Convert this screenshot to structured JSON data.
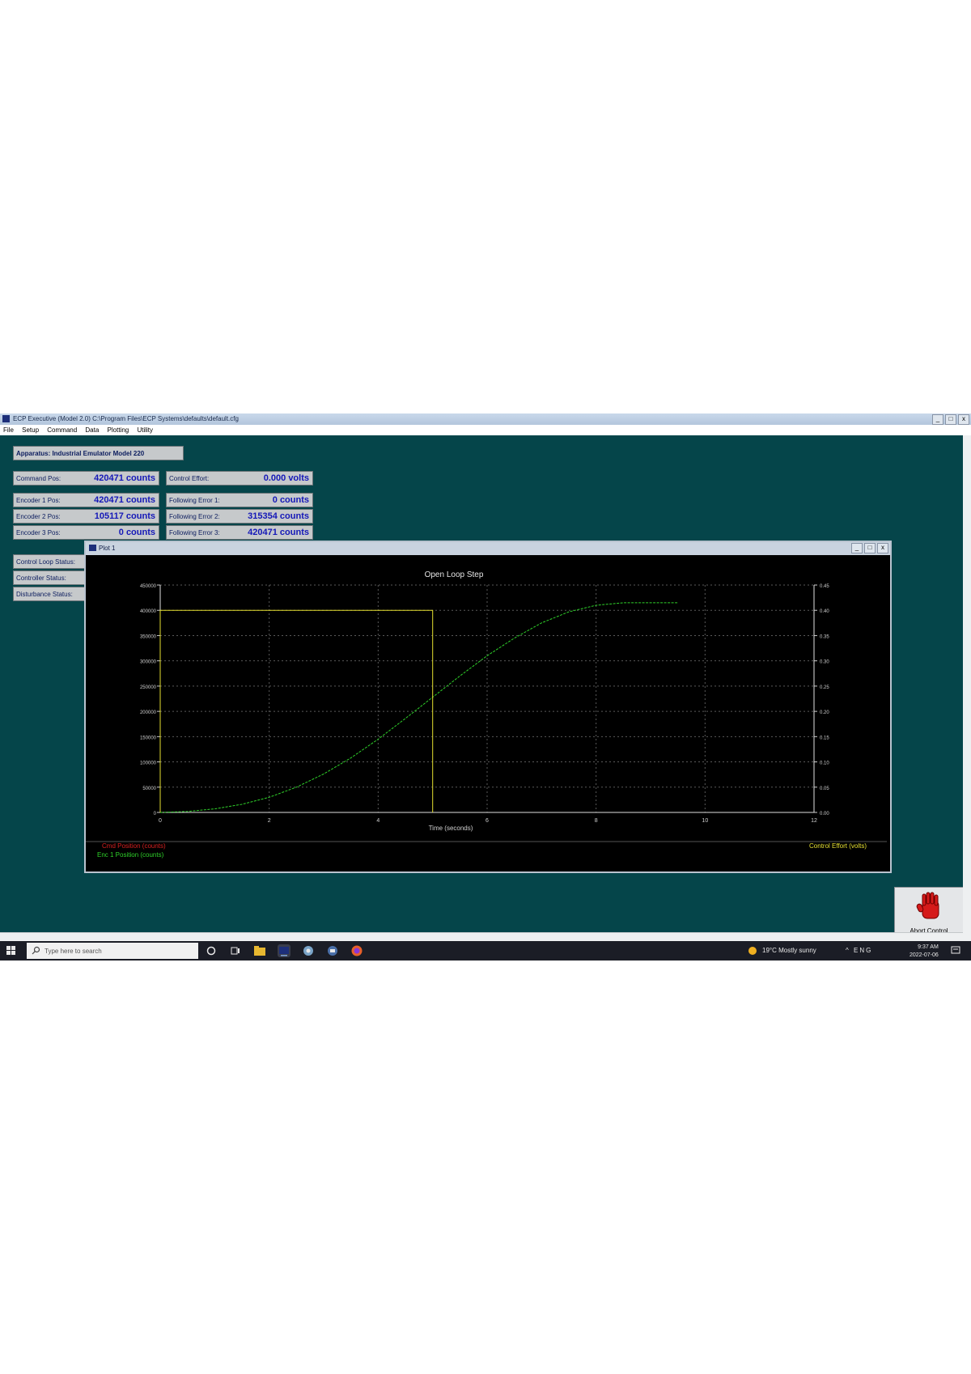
{
  "window": {
    "title": "ECP Executive (Model 2.0)  C:\\Program Files\\ECP Systems\\defaults\\default.cfg",
    "controls": [
      "_",
      "□",
      "x"
    ]
  },
  "menu": [
    "File",
    "Setup",
    "Command",
    "Data",
    "Plotting",
    "Utility"
  ],
  "panels": {
    "apparatus": "Apparatus: Industrial Emulator Model 220",
    "command_pos": {
      "label": "Command Pos:",
      "value": "420471 counts"
    },
    "control_effort": {
      "label": "Control Effort:",
      "value": "0.000 volts"
    },
    "encoder1": {
      "label": "Encoder 1 Pos:",
      "value": "420471 counts"
    },
    "following1": {
      "label": "Following Error 1:",
      "value": "0 counts"
    },
    "encoder2": {
      "label": "Encoder 2 Pos:",
      "value": "105117 counts"
    },
    "following2": {
      "label": "Following Error 2:",
      "value": "315354 counts"
    },
    "encoder3": {
      "label": "Encoder 3 Pos:",
      "value": "0 counts"
    },
    "following3": {
      "label": "Following Error 3:",
      "value": "420471 counts"
    },
    "control_loop": "Control Loop Status:",
    "controller_status": "Controller Status:",
    "disturbance_status": "Disturbance Status:"
  },
  "plot_window": {
    "title": "Plot 1",
    "controls": [
      "_",
      "□",
      "x"
    ]
  },
  "chart_data": {
    "type": "line",
    "title": "Open Loop Step",
    "xlabel": "Time (seconds)",
    "xlim": [
      0,
      12
    ],
    "ylim_left": [
      0,
      450000
    ],
    "ylim_right": [
      0,
      0.45
    ],
    "x_ticks": [
      "0",
      "2",
      "4",
      "6",
      "8",
      "10",
      "12"
    ],
    "y_ticks_left": [
      "0",
      "50000",
      "100000",
      "150000",
      "200000",
      "250000",
      "300000",
      "350000",
      "400000",
      "450000"
    ],
    "y_ticks_right": [
      "0.00",
      "0.05",
      "0.10",
      "0.15",
      "0.20",
      "0.25",
      "0.30",
      "0.35",
      "0.40",
      "0.45"
    ],
    "grid": true,
    "legend_left": [
      "Cmd Position (counts)",
      "Enc 1 Position (counts)"
    ],
    "legend_right": [
      "Control Effort (volts)"
    ],
    "series": [
      {
        "name": "Enc 1 Position (counts)",
        "color": "#2fd12a",
        "axis": "left",
        "x": [
          0,
          0.5,
          1,
          1.5,
          2,
          2.5,
          3,
          3.5,
          4,
          4.5,
          5,
          5.5,
          6,
          6.5,
          7,
          7.5,
          8,
          8.5,
          9,
          9.5
        ],
        "y": [
          0,
          2000,
          7000,
          16000,
          30000,
          50000,
          76000,
          108000,
          145000,
          186000,
          228000,
          270000,
          310000,
          345000,
          375000,
          397000,
          410000,
          415000,
          415000,
          415000
        ]
      },
      {
        "name": "Control Effort (volts)",
        "color": "#e6e030",
        "axis": "right",
        "x": [
          0,
          0,
          5,
          5,
          5,
          5
        ],
        "y": [
          0,
          0.4,
          0.4,
          0.25,
          0.25,
          0
        ]
      }
    ]
  },
  "stop_button": {
    "label": "Abort Control"
  },
  "taskbar": {
    "search_placeholder": "Type here to search",
    "weather": "19°C  Mostly sunny",
    "tray": "^  ENG",
    "time": "9:37 AM",
    "date": "2022-07-06"
  },
  "colors": {
    "desktop": "#05454a",
    "panel": "#c6c9cb",
    "value_text": "#1418b8",
    "plot_bg": "#000000"
  }
}
